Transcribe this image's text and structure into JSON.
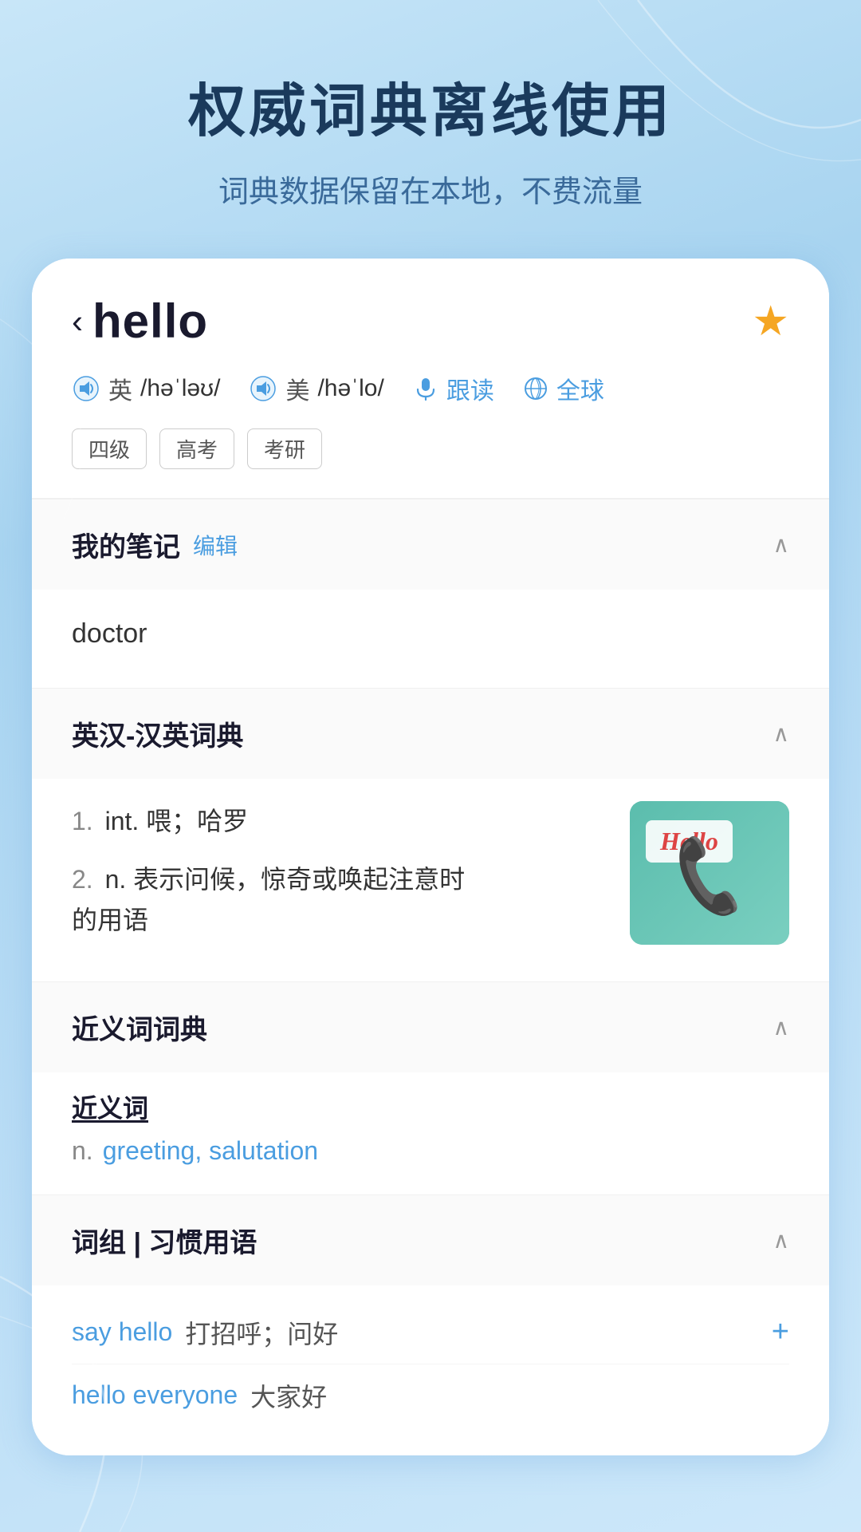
{
  "background": {
    "gradient_start": "#c8e6f8",
    "gradient_end": "#a8d4f0"
  },
  "top": {
    "main_title": "权威词典离线使用",
    "sub_title": "词典数据保留在本地，不费流量"
  },
  "card": {
    "header": {
      "back_symbol": "‹",
      "word": "hello",
      "star_symbol": "★",
      "phonetics": [
        {
          "type": "british",
          "label": "英",
          "ipa": "/həˈləʊ/"
        },
        {
          "type": "american",
          "label": "美",
          "ipa": "/həˈlo/"
        }
      ],
      "follow_read_label": "跟读",
      "global_label": "全球",
      "tags": [
        "四级",
        "高考",
        "考研"
      ]
    },
    "notes_section": {
      "title": "我的笔记",
      "edit_label": "编辑",
      "chevron": "∧",
      "content": "doctor"
    },
    "dict_section": {
      "title": "英汉-汉英词典",
      "chevron": "∧",
      "definitions": [
        {
          "num": "1.",
          "text": "int. 喂；哈罗"
        },
        {
          "num": "2.",
          "text": "n. 表示问候，惊奇或唤起注意时的用语"
        }
      ],
      "image_label": "Hello"
    },
    "synonym_section": {
      "title": "近义词词典",
      "chevron": "∧",
      "synonym_heading": "近义词",
      "pos": "n.",
      "words": "greeting, salutation"
    },
    "phrases_section": {
      "title": "词组 | 习惯用语",
      "chevron": "∧",
      "phrases": [
        {
          "en": "say hello",
          "zh": "打招呼；问好"
        },
        {
          "en": "hello everyone",
          "zh": "大家好"
        }
      ],
      "plus_symbol": "+"
    }
  }
}
